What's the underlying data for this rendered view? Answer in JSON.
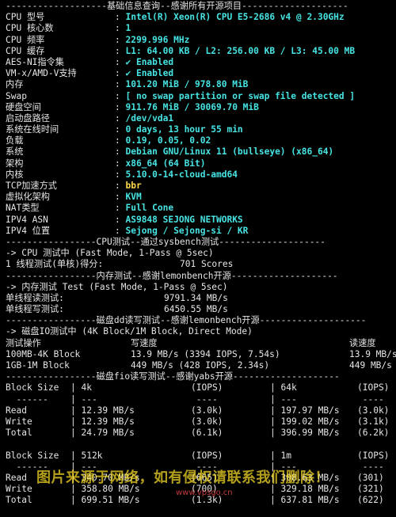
{
  "section_basic": "-------------------基础信息查询--感谢所有开源项目--------------------",
  "info": [
    {
      "k": "CPU 型号",
      "v": "Intel(R) Xeon(R) CPU E5-2686 v4 @ 2.30GHz"
    },
    {
      "k": "CPU 核心数",
      "v": "1"
    },
    {
      "k": "CPU 频率",
      "v": "2299.996 MHz"
    },
    {
      "k": "CPU 缓存",
      "v": "L1: 64.00 KB / L2: 256.00 KB / L3: 45.00 MB"
    },
    {
      "k": "AES-NI指令集",
      "v": "✔ Enabled"
    },
    {
      "k": "VM-x/AMD-V支持",
      "v": "✔ Enabled"
    },
    {
      "k": "内存",
      "v": "101.20 MiB / 978.80 MiB"
    },
    {
      "k": "Swap",
      "v": "[ no swap partition or swap file detected ]"
    },
    {
      "k": "硬盘空间",
      "v": "911.76 MiB / 30069.70 MiB"
    },
    {
      "k": "启动盘路径",
      "v": "/dev/vda1"
    },
    {
      "k": "系统在线时间",
      "v": "0 days, 13 hour 55 min"
    },
    {
      "k": "负载",
      "v": "0.19, 0.05, 0.02"
    },
    {
      "k": "系统",
      "v": "Debian GNU/Linux 11 (bullseye) (x86_64)"
    },
    {
      "k": "架构",
      "v": "x86_64 (64 Bit)"
    },
    {
      "k": "内核",
      "v": "5.10.0-14-cloud-amd64"
    },
    {
      "k": "TCP加速方式",
      "v": "bbr"
    },
    {
      "k": "虚拟化架构",
      "v": "KVM"
    },
    {
      "k": "NAT类型",
      "v": "Full Cone"
    },
    {
      "k": "IPV4 ASN",
      "v": "AS9848 SEJONG NETWORKS"
    },
    {
      "k": "IPV4 位置",
      "v": "Sejong / Sejong-si / KR"
    }
  ],
  "section_cpu": "-----------------CPU测试--通过sysbench测试--------------------",
  "cpu_test": "-> CPU 测试中 (Fast Mode, 1-Pass @ 5sec)",
  "cpu_result_label": "1 线程测试(单核)得分:",
  "cpu_result_value": "701 Scores",
  "section_mem": "-----------------内存测试--感谢lemonbench开源--------------------",
  "mem_test": "-> 内存测试 Test (Fast Mode, 1-Pass @ 5sec)",
  "mem_read_label": "单线程读测试:",
  "mem_read_value": "9791.34 MB/s",
  "mem_write_label": "单线程写测试:",
  "mem_write_value": "6450.55 MB/s",
  "section_dd": "-----------------磁盘dd读写测试--感谢lemonbench开源--------------------",
  "dd_test": "-> 磁盘IO测试中 (4K Block/1M Block, Direct Mode)",
  "dd_header": {
    "op": "测试操作",
    "write": "写速度",
    "read": "读速度"
  },
  "dd_rows": [
    {
      "op": "100MB-4K Block",
      "write": "13.9 MB/s (3394 IOPS, 7.54s)",
      "read": "13.9 MB/s"
    },
    {
      "op": "1GB-1M Block",
      "write": "449 MB/s (428 IOPS, 2.34s)",
      "read": "449 MB/s"
    }
  ],
  "section_fio": "-----------------磁盘fio读写测试--感谢yabs开源--------------------",
  "fio_blocks": [
    {
      "head": {
        "label": "Block Size",
        "b1": "4k",
        "iops1": "(IOPS)",
        "b2": "64k",
        "iops2": "(IOPS)"
      },
      "rows": [
        {
          "label": "Read",
          "s1": "12.39 MB/s",
          "i1": "(3.0k)",
          "s2": "197.97 MB/s",
          "i2": "(3.0k)"
        },
        {
          "label": "Write",
          "s1": "12.39 MB/s",
          "i1": "(3.0k)",
          "s2": "199.02 MB/s",
          "i2": "(3.1k)"
        },
        {
          "label": "Total",
          "s1": "24.79 MB/s",
          "i1": "(6.1k)",
          "s2": "396.99 MB/s",
          "i2": "(6.2k)"
        }
      ]
    },
    {
      "head": {
        "label": "Block Size",
        "b1": "512k",
        "iops1": "(IOPS)",
        "b2": "1m",
        "iops2": "(IOPS)"
      },
      "rows": [
        {
          "label": "Read",
          "s1": "340.70 MB/s",
          "i1": "(665)",
          "s2": "308.63 MB/s",
          "i2": "(301)"
        },
        {
          "label": "Write",
          "s1": "358.80 MB/s",
          "i1": "(700)",
          "s2": "329.18 MB/s",
          "i2": "(321)"
        },
        {
          "label": "Total",
          "s1": "699.51 MB/s",
          "i1": "(1.3k)",
          "s2": "637.81 MB/s",
          "i2": "(622)"
        }
      ]
    }
  ],
  "watermark": "图片来源于网络，如有侵权请联系我们删除！",
  "watermark_site": "www.vpsgo.cn",
  "colors": {
    "background": "#000000",
    "value": "#47e4e4",
    "highlight": "#ffd84a",
    "text": "#e6e6e6"
  }
}
